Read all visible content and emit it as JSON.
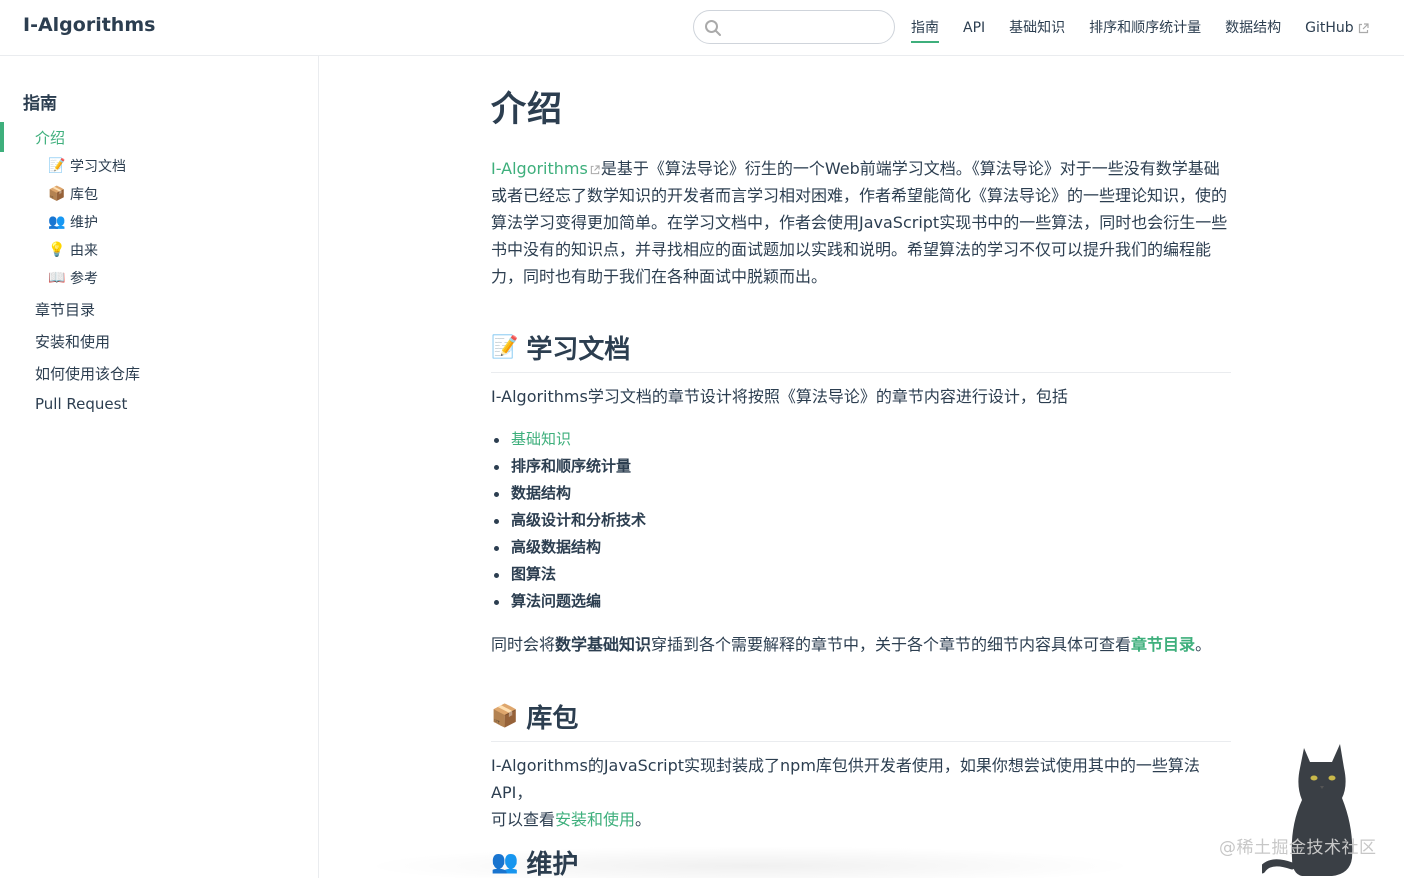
{
  "navbar": {
    "site_name": "I-Algorithms",
    "search_value": "",
    "items": [
      {
        "label": "指南",
        "active": true
      },
      {
        "label": "API"
      },
      {
        "label": "基础知识"
      },
      {
        "label": "排序和顺序统计量"
      },
      {
        "label": "数据结构"
      },
      {
        "label": "GitHub",
        "external": true
      }
    ]
  },
  "sidebar": {
    "heading": "指南",
    "active_item": "介绍",
    "sub_items": [
      {
        "icon": "📝",
        "label": "学习文档"
      },
      {
        "icon": "📦",
        "label": "库包"
      },
      {
        "icon": "👥",
        "label": "维护"
      },
      {
        "icon": "💡",
        "label": "由来"
      },
      {
        "icon": "📖",
        "label": "参考"
      }
    ],
    "items": [
      {
        "label": "章节目录"
      },
      {
        "label": "安装和使用"
      },
      {
        "label": "如何使用该仓库"
      },
      {
        "label": "Pull Request"
      }
    ]
  },
  "content": {
    "title": "介绍",
    "intro": {
      "link": "I-Algorithms",
      "line1": "是基于《算法导论》衍生的一个Web前端学习文档。《算法导论》对于一些没有数学基础",
      "line2": "或者已经忘了数学知识的开发者而言学习相对困难，作者希望能简化《算法导论》的一些理论知识，使的",
      "line3": "算法学习变得更加简单。在学习文档中，作者会使用JavaScript实现书中的一些算法，同时也会衍生一些",
      "line4": "书中没有的知识点，并寻找相应的面试题加以实践和说明。希望算法的学习不仅可以提升我们的编程能",
      "line5": "力，同时也有助于我们在各种面试中脱颖而出。"
    },
    "section_docs": {
      "icon": "📝",
      "title": "学习文档",
      "desc": "I-Algorithms学习文档的章节设计将按照《算法导论》的章节内容进行设计，包括",
      "bullets": [
        "基础知识",
        "排序和顺序统计量",
        "数据结构",
        "高级设计和分析技术",
        "高级数据结构",
        "图算法",
        "算法问题选编"
      ],
      "note_prefix": "同时会将",
      "note_bold": "数学基础知识",
      "note_middle": "穿插到各个需要解释的章节中，关于各个章节的细节内容具体可查看",
      "note_link": "章节目录",
      "note_suffix": "。"
    },
    "section_pkg": {
      "icon": "📦",
      "title": "库包",
      "line1": "I-Algorithms的JavaScript实现封装成了npm库包供开发者使用，如果你想尝试使用其中的一些算法API，",
      "line2_prefix": "可以查看",
      "line2_link": "安装和使用",
      "line2_suffix": "。"
    },
    "section_maint": {
      "icon": "👥",
      "title": "维护"
    }
  },
  "watermark": "@稀土掘金技术社区",
  "colors": {
    "accent": "#3eaf7c",
    "text": "#2c3e50",
    "border": "#eaecef"
  }
}
